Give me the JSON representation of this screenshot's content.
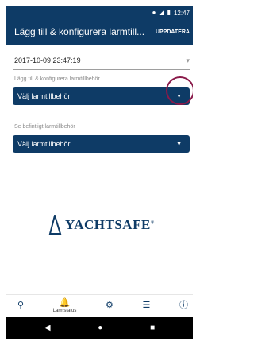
{
  "status_bar": {
    "time": "12:47",
    "icons": [
      "location-icon",
      "signal-icon",
      "battery-icon"
    ]
  },
  "app_bar": {
    "title": "Lägg till & konfigurera larmtill...",
    "action_label": "UPPDATERA"
  },
  "content": {
    "datetime_value": "2017-10-09 23:47:19",
    "add_section": {
      "label": "Lägg till & konfigurera larmtillbehör",
      "dropdown_value": "Välj larmtillbehör"
    },
    "existing_section": {
      "label": "Se befintligt larmtillbehör",
      "dropdown_value": "Välj larmtillbehör"
    }
  },
  "logo": {
    "text": "YACHTSAFE",
    "reg_mark": "®"
  },
  "bottom_nav": {
    "items": [
      {
        "icon": "location-pin-icon",
        "label": ""
      },
      {
        "icon": "bell-icon",
        "label": "Larmstatus"
      },
      {
        "icon": "gear-icon",
        "label": ""
      },
      {
        "icon": "list-icon",
        "label": ""
      },
      {
        "icon": "info-icon",
        "label": ""
      }
    ]
  },
  "system_nav": {
    "buttons": [
      "back-icon",
      "home-icon",
      "recents-icon"
    ]
  },
  "colors": {
    "primary": "#0e3b66",
    "tap_ring": "#8a1a4a",
    "label_gray": "#8a8a8a"
  }
}
